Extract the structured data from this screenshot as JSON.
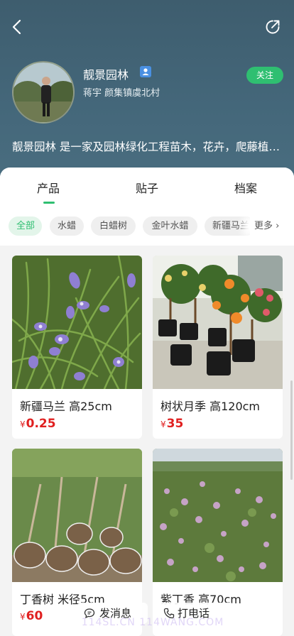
{
  "header": {
    "back_icon": "chevron-left-icon",
    "share_icon": "share-icon",
    "store_name": "靓景园林",
    "verify_icon": "verified-badge-icon",
    "location": "蒋宇 颜集镇虞北村",
    "follow_label": "关注",
    "description": "靓景园林 是一家及园林绿化工程苗木，花卉，爬藤植物，水生植物，地被植物，宿根花卉等的园林公司"
  },
  "tabs": [
    {
      "label": "产品"
    },
    {
      "label": "贴子"
    },
    {
      "label": "档案"
    }
  ],
  "categories": [
    "全部",
    "水蜡",
    "白蜡树",
    "金叶水蜡",
    "新疆马兰"
  ],
  "more_label": "更多",
  "products": [
    {
      "title": "新疆马兰 高25cm",
      "currency": "¥",
      "price": "0.25"
    },
    {
      "title": "树状月季 高120cm",
      "currency": "¥",
      "price": "35"
    },
    {
      "title": "丁香树 米径5cm",
      "currency": "¥",
      "price": "60"
    },
    {
      "title": "紫丁香 高70cm",
      "currency": "¥",
      "price": ""
    }
  ],
  "bottom_bar": {
    "message_label": "发消息",
    "call_label": "打电话",
    "watermark": "114SL.CN 114WANG.COM"
  },
  "colors": {
    "accent": "#2fbf71",
    "price": "#e02020",
    "header_bg": "#44677a"
  }
}
